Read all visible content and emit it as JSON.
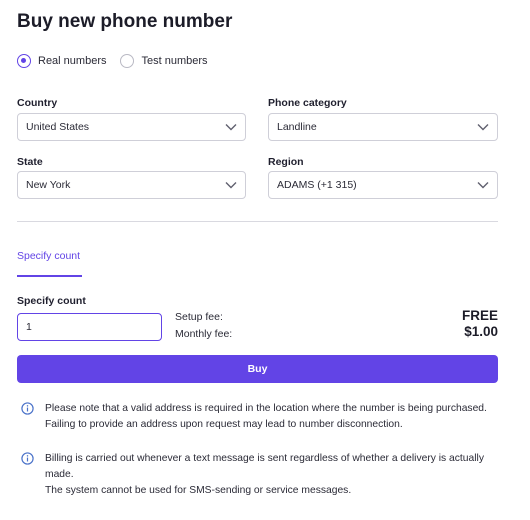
{
  "title": "Buy new phone number",
  "number_type": {
    "options": [
      {
        "label": "Real numbers",
        "checked": true
      },
      {
        "label": "Test numbers",
        "checked": false
      }
    ]
  },
  "fields": {
    "country": {
      "label": "Country",
      "value": "United States"
    },
    "phone_category": {
      "label": "Phone category",
      "value": "Landline"
    },
    "state": {
      "label": "State",
      "value": "New York"
    },
    "region": {
      "label": "Region",
      "value": "ADAMS (+1 315)"
    }
  },
  "tab": {
    "label": "Specify count"
  },
  "count": {
    "label": "Specify count",
    "value": "1"
  },
  "fees": {
    "setup_label": "Setup fee:",
    "setup_value": "FREE",
    "monthly_label": "Monthly fee:",
    "monthly_value": "$1.00"
  },
  "buy_button": {
    "label": "Buy"
  },
  "notes": [
    {
      "lines": [
        "Please note that a valid address is required in the location where the number is being purchased. Failing to provide an address upon request may lead to number disconnection."
      ]
    },
    {
      "lines": [
        "Billing is carried out whenever a text message is sent regardless of whether a delivery is actually made.",
        "The system cannot be used for SMS-sending or service messages."
      ]
    }
  ],
  "colors": {
    "accent": "#6244e6",
    "border": "#cfcfd8",
    "text": "#1f1f2e"
  },
  "icons": {
    "select_arrow": "chevron-down-icon",
    "note": "info-icon"
  }
}
